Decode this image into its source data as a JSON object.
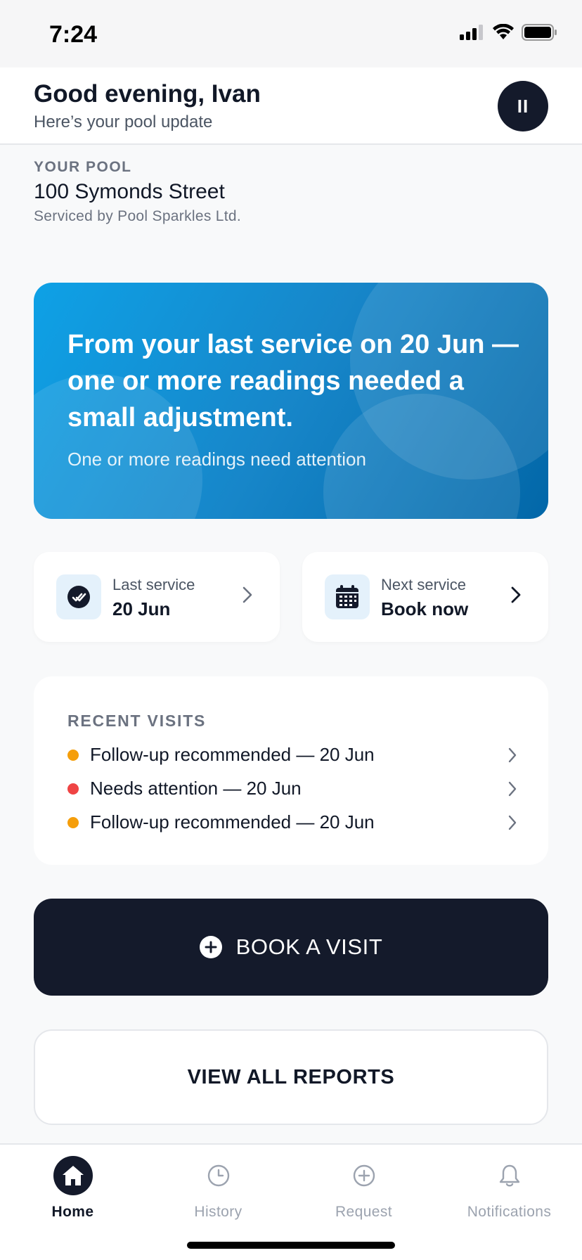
{
  "status_bar": {
    "time": "7:24"
  },
  "header": {
    "greeting": "Good evening, Ivan",
    "subtitle": "Here’s your pool update",
    "avatar_label": "II"
  },
  "pool": {
    "eyebrow": "YOUR POOL",
    "address": "100 Symonds Street",
    "serviced_by": "Serviced by Pool Sparkles Ltd."
  },
  "hero": {
    "title": "From your last service on 20 Jun — one or more readings needed a small adjustment.",
    "subtitle": "One or more readings need attention"
  },
  "service_cards": {
    "last": {
      "label": "Last service",
      "value": "20 Jun",
      "icon": "check-circle-icon"
    },
    "next": {
      "label": "Next service",
      "value": "Book now",
      "icon": "calendar-icon"
    }
  },
  "recent_visits": {
    "title": "RECENT VISITS",
    "items": [
      {
        "text": "Follow-up recommended — 20 Jun",
        "status_color": "#f59e0b"
      },
      {
        "text": "Needs attention — 20 Jun",
        "status_color": "#ef4444"
      },
      {
        "text": "Follow-up recommended — 20 Jun",
        "status_color": "#f59e0b"
      }
    ]
  },
  "actions": {
    "book_label": "BOOK A VISIT",
    "reports_label": "VIEW ALL REPORTS"
  },
  "tabbar": {
    "items": [
      {
        "label": "Home",
        "icon": "home-icon",
        "active": true
      },
      {
        "label": "History",
        "icon": "clock-icon",
        "active": false
      },
      {
        "label": "Request",
        "icon": "plus-circle-icon",
        "active": false
      },
      {
        "label": "Notifications",
        "icon": "bell-icon",
        "active": false
      }
    ]
  },
  "colors": {
    "primary_dark": "#141a2b",
    "hero_start": "#0ea1e6",
    "hero_end": "#0267a8",
    "warning": "#f59e0b",
    "danger": "#ef4444"
  }
}
